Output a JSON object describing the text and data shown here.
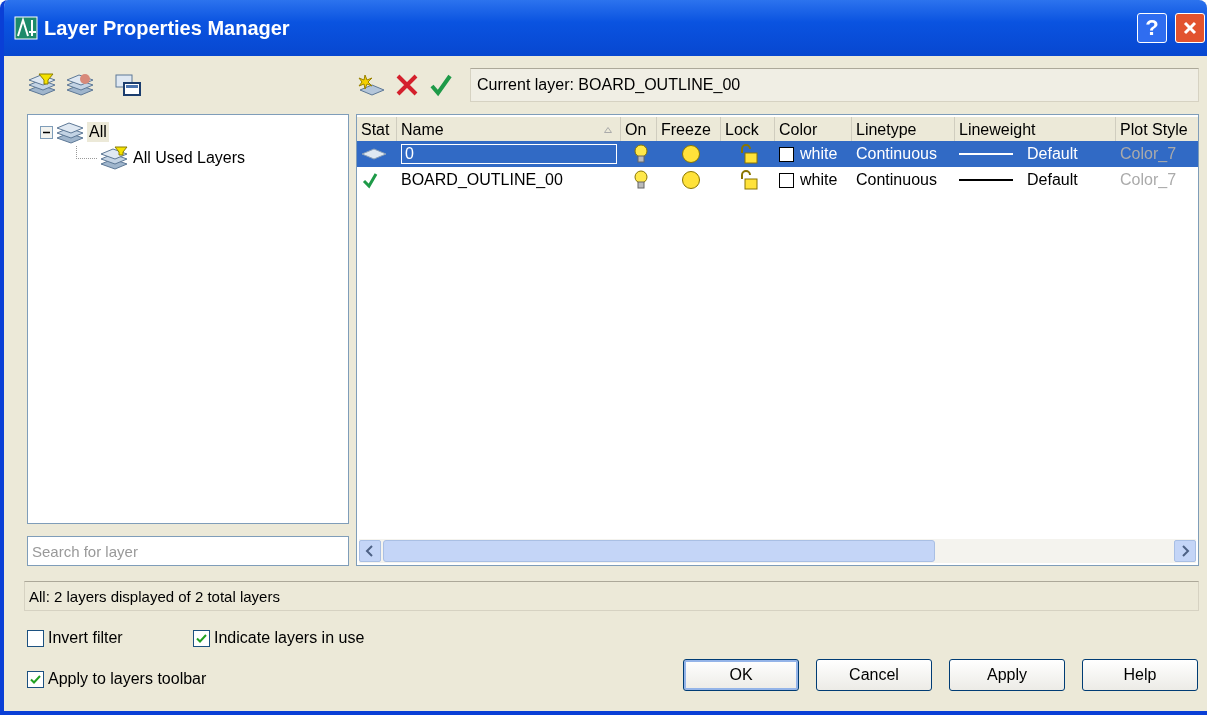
{
  "window": {
    "title": "Layer Properties Manager",
    "help_button": "?"
  },
  "current_layer": "Current layer: BOARD_OUTLINE_00",
  "filter_tree": [
    {
      "label": "All",
      "selected": true,
      "expanded": true,
      "children": [
        {
          "label": "All Used Layers",
          "selected": false
        }
      ]
    }
  ],
  "search": {
    "placeholder": "Search for layer"
  },
  "table": {
    "columns": [
      {
        "label": "Stat",
        "kind": "status"
      },
      {
        "label": "Name",
        "kind": "name",
        "sorted": true
      },
      {
        "label": "On",
        "kind": "on"
      },
      {
        "label": "Freeze",
        "kind": "freeze"
      },
      {
        "label": "Lock",
        "kind": "lock"
      },
      {
        "label": "Color",
        "kind": "color"
      },
      {
        "label": "Linetype",
        "kind": "linetype"
      },
      {
        "label": "Lineweight",
        "kind": "lineweight"
      },
      {
        "label": "Plot Style",
        "kind": "plotstyle"
      }
    ],
    "rows": [
      {
        "kind": "layer",
        "name": "0",
        "editing": true,
        "selected": true,
        "on": true,
        "frozen": false,
        "locked": false,
        "color": "#ffffff",
        "color_name": "white",
        "linetype": "Continuous",
        "lineweight": "Default",
        "plot_style": "Color_7"
      },
      {
        "kind": "current",
        "name": "BOARD_OUTLINE_00",
        "editing": false,
        "selected": false,
        "on": true,
        "frozen": false,
        "locked": false,
        "color": "#ffffff",
        "color_name": "white",
        "linetype": "Continuous",
        "lineweight": "Default",
        "plot_style": "Color_7"
      }
    ]
  },
  "status_bar": "All: 2 layers displayed of 2 total layers",
  "options": [
    {
      "label": "Invert filter",
      "checked": false
    },
    {
      "label": "Indicate layers in use",
      "checked": true
    },
    {
      "label": "Apply to layers toolbar",
      "checked": true
    }
  ],
  "buttons": [
    {
      "label": "OK",
      "default": true
    },
    {
      "label": "Cancel",
      "default": false
    },
    {
      "label": "Apply",
      "default": false
    },
    {
      "label": "Help",
      "default": false
    }
  ]
}
